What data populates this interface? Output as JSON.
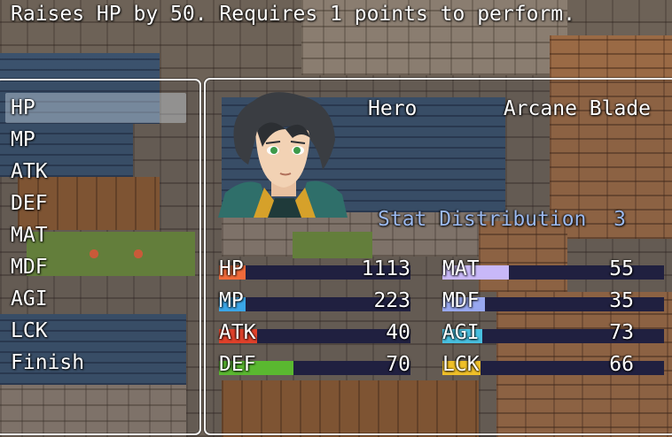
{
  "help": {
    "text": "Raises HP by 50. Requires 1 points to perform."
  },
  "commands": {
    "items": [
      {
        "label": "HP",
        "selected": true
      },
      {
        "label": "MP"
      },
      {
        "label": "ATK"
      },
      {
        "label": "DEF"
      },
      {
        "label": "MAT"
      },
      {
        "label": "MDF"
      },
      {
        "label": "AGI"
      },
      {
        "label": "LCK"
      },
      {
        "label": "Finish"
      }
    ]
  },
  "actor": {
    "name": "Hero",
    "class": "Arcane Blade",
    "portrait_icon": "hero-face-portrait"
  },
  "distribution": {
    "label": "Stat Distribution",
    "points": "3"
  },
  "stats": [
    {
      "label": "HP",
      "value": "1113",
      "fill_ratio": 0.14,
      "color": "#f06a3a"
    },
    {
      "label": "MP",
      "value": "223",
      "fill_ratio": 0.14,
      "color": "#3aa6e8"
    },
    {
      "label": "ATK",
      "value": "40",
      "fill_ratio": 0.2,
      "color": "#e0402a"
    },
    {
      "label": "DEF",
      "value": "70",
      "fill_ratio": 0.39,
      "color": "#5ab830"
    },
    {
      "label": "MAT",
      "value": "55",
      "fill_ratio": 0.3,
      "color": "#c8b8f8"
    },
    {
      "label": "MDF",
      "value": "35",
      "fill_ratio": 0.19,
      "color": "#98a8f0"
    },
    {
      "label": "AGI",
      "value": "73",
      "fill_ratio": 0.18,
      "color": "#48c0e0"
    },
    {
      "label": "LCK",
      "value": "66",
      "fill_ratio": 0.17,
      "color": "#f0c028"
    }
  ],
  "colors": {
    "window_border": "#f4f4f4",
    "system_text": "#9ab8ee",
    "gauge_back": "#202040"
  }
}
